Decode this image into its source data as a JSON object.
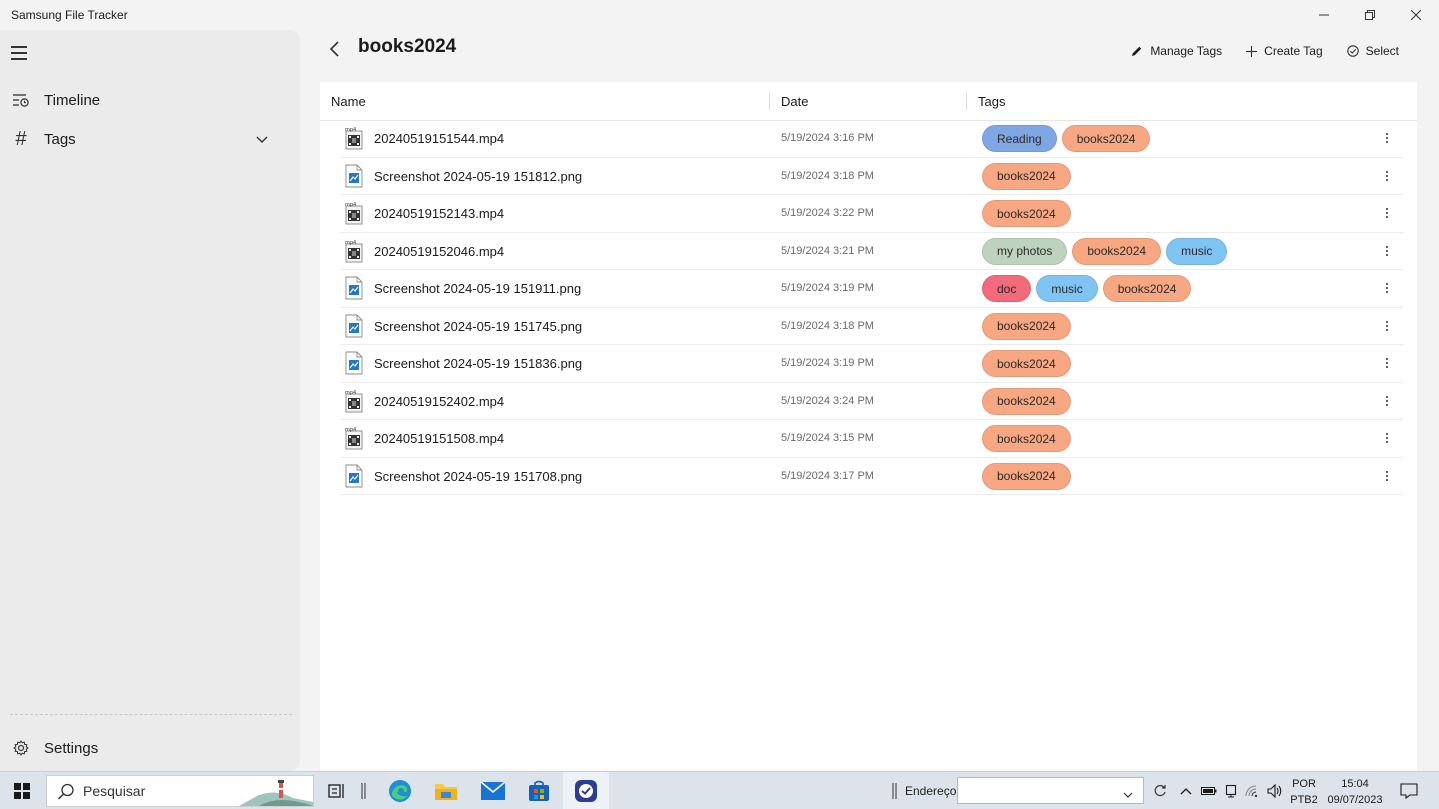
{
  "window": {
    "title": "Samsung File Tracker"
  },
  "sidebar": {
    "items": [
      {
        "label": "Timeline",
        "icon": "timeline-icon"
      },
      {
        "label": "Tags",
        "icon": "hash-icon"
      }
    ],
    "settings_label": "Settings"
  },
  "header": {
    "title": "books2024",
    "manage_tags": "Manage Tags",
    "create_tag": "Create Tag",
    "select": "Select"
  },
  "table": {
    "columns": [
      "Name",
      "Date",
      "Tags"
    ],
    "rows": [
      {
        "type": "mp4",
        "name": "20240519151544.mp4",
        "date": "5/19/2024 3:16 PM",
        "tags": [
          "Reading",
          "books2024"
        ]
      },
      {
        "type": "png",
        "name": "Screenshot 2024-05-19 151812.png",
        "date": "5/19/2024 3:18 PM",
        "tags": [
          "books2024"
        ]
      },
      {
        "type": "mp4",
        "name": "20240519152143.mp4",
        "date": "5/19/2024 3:22 PM",
        "tags": [
          "books2024"
        ]
      },
      {
        "type": "mp4",
        "name": "20240519152046.mp4",
        "date": "5/19/2024 3:21 PM",
        "tags": [
          "my photos",
          "books2024",
          "music"
        ]
      },
      {
        "type": "png",
        "name": "Screenshot 2024-05-19 151911.png",
        "date": "5/19/2024 3:19 PM",
        "tags": [
          "doc",
          "music",
          "books2024"
        ]
      },
      {
        "type": "png",
        "name": "Screenshot 2024-05-19 151745.png",
        "date": "5/19/2024 3:18 PM",
        "tags": [
          "books2024"
        ]
      },
      {
        "type": "png",
        "name": "Screenshot 2024-05-19 151836.png",
        "date": "5/19/2024 3:19 PM",
        "tags": [
          "books2024"
        ]
      },
      {
        "type": "mp4",
        "name": "20240519152402.mp4",
        "date": "5/19/2024 3:24 PM",
        "tags": [
          "books2024"
        ]
      },
      {
        "type": "mp4",
        "name": "20240519151508.mp4",
        "date": "5/19/2024 3:15 PM",
        "tags": [
          "books2024"
        ]
      },
      {
        "type": "png",
        "name": "Screenshot 2024-05-19 151708.png",
        "date": "5/19/2024 3:17 PM",
        "tags": [
          "books2024"
        ]
      }
    ]
  },
  "tag_colors": {
    "Reading": "#7fa7e3",
    "books2024": "#f7a883",
    "my photos": "#bdd3bd",
    "music": "#7fc4f2",
    "doc": "#f26b7a"
  },
  "taskbar": {
    "search_placeholder": "Pesquisar",
    "address_label": "Endereço",
    "lang_top": "POR",
    "lang_bottom": "PTB2",
    "time": "15:04",
    "date": "09/07/2023"
  }
}
